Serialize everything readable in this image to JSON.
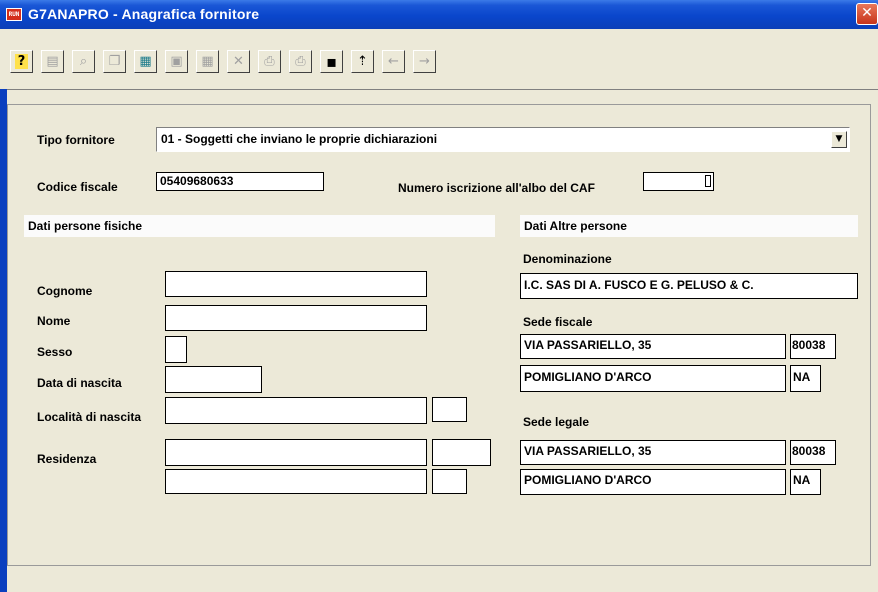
{
  "window": {
    "app_icon_text": "RUN",
    "title": "G7ANAPRO - Anagrafica fornitore",
    "close_glyph": "✕"
  },
  "toolbar": [
    {
      "name": "help-button",
      "icon": "question-icon",
      "glyph": "?",
      "enabled": true
    },
    {
      "name": "properties-button",
      "icon": "properties-icon",
      "glyph": "▤",
      "enabled": false
    },
    {
      "name": "search-button",
      "icon": "binoculars-icon",
      "glyph": "⌕",
      "enabled": false
    },
    {
      "name": "copy-record-button",
      "icon": "copy-icon",
      "glyph": "❐",
      "enabled": false
    },
    {
      "name": "calculator-button",
      "icon": "calculator-icon",
      "glyph": "▦",
      "enabled": true
    },
    {
      "name": "paste-button",
      "icon": "paste-icon",
      "glyph": "▣",
      "enabled": false
    },
    {
      "name": "grid-button",
      "icon": "grid-icon",
      "glyph": "▦",
      "enabled": false
    },
    {
      "name": "delete-button",
      "icon": "delete-icon",
      "glyph": "✕",
      "enabled": false
    },
    {
      "name": "preview-button",
      "icon": "preview-icon",
      "glyph": "⎙",
      "enabled": false
    },
    {
      "name": "print-button",
      "icon": "printer-icon",
      "glyph": "⎙",
      "enabled": false
    },
    {
      "name": "save-button",
      "icon": "floppy-icon",
      "glyph": "▪",
      "enabled": true
    },
    {
      "name": "exit-button",
      "icon": "exit-icon",
      "glyph": "⇡",
      "enabled": true
    },
    {
      "name": "previous-button",
      "icon": "arrow-left-icon",
      "glyph": "←",
      "enabled": false
    },
    {
      "name": "next-button",
      "icon": "arrow-right-icon",
      "glyph": "→",
      "enabled": false
    }
  ],
  "form": {
    "tipo_fornitore": {
      "label": "Tipo fornitore",
      "value": "01 - Soggetti che inviano le proprie dichiarazioni",
      "arrow": "▼"
    },
    "codice_fiscale": {
      "label": "Codice fiscale",
      "value": "05409680633"
    },
    "numero_iscrizione": {
      "label": "Numero iscrizione all'albo del CAF",
      "value": ""
    },
    "persone_fisiche": {
      "section_title": "Dati persone fisiche",
      "cognome": {
        "label": "Cognome",
        "value": ""
      },
      "nome": {
        "label": "Nome",
        "value": ""
      },
      "sesso": {
        "label": "Sesso",
        "value": ""
      },
      "data_nascita": {
        "label": "Data di nascita",
        "value": ""
      },
      "localita_nascita": {
        "label": "Località di nascita",
        "value": "",
        "provincia": ""
      },
      "residenza": {
        "label": "Residenza",
        "indirizzo": "",
        "cap": "",
        "comune": "",
        "provincia": ""
      }
    },
    "altre_persone": {
      "section_title": "Dati Altre persone",
      "denominazione": {
        "label": "Denominazione",
        "value": "I.C. SAS DI A. FUSCO E G. PELUSO & C."
      },
      "sede_fiscale": {
        "label": "Sede fiscale",
        "indirizzo": "VIA PASSARIELLO, 35",
        "cap": "80038",
        "comune": "POMIGLIANO D'ARCO",
        "provincia": "NA"
      },
      "sede_legale": {
        "label": "Sede legale",
        "indirizzo": "VIA PASSARIELLO, 35",
        "cap": "80038",
        "comune": "POMIGLIANO D'ARCO",
        "provincia": "NA"
      }
    }
  },
  "colors": {
    "titlebar": "#0a46cc",
    "window_bg": "#ece9d8",
    "field_bg": "#ffffff",
    "left_border": "#0a3fbf"
  }
}
